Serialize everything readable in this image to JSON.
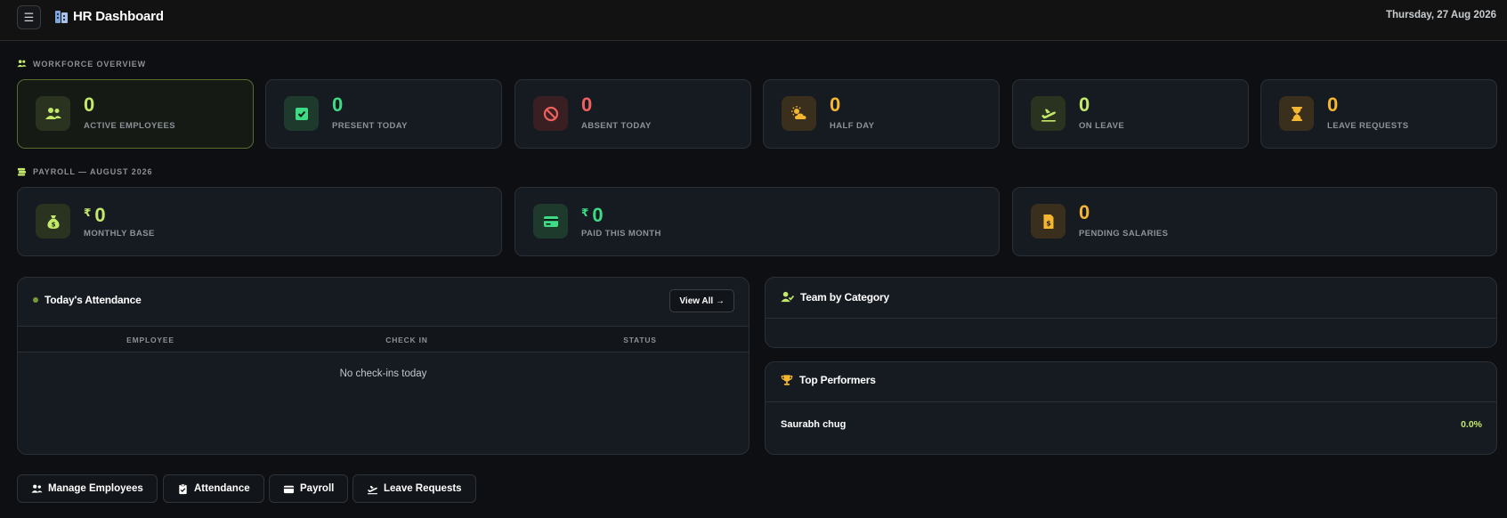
{
  "header": {
    "title": "HR Dashboard",
    "date": "Thursday, 27 Aug 2026",
    "menu_icon": "hamburger-menu-icon",
    "brand_icon": "building-icon"
  },
  "workforce": {
    "label": "WORKFORCE OVERVIEW",
    "cards": [
      {
        "value": "0",
        "label": "ACTIVE EMPLOYEES",
        "icon": "users-icon",
        "color": "#c4e86a"
      },
      {
        "value": "0",
        "label": "PRESENT TODAY",
        "icon": "check-square-icon",
        "color": "#3ddc84"
      },
      {
        "value": "0",
        "label": "ABSENT TODAY",
        "icon": "ban-icon",
        "color": "#f0605e"
      },
      {
        "value": "0",
        "label": "HALF DAY",
        "icon": "cloud-sun-icon",
        "color": "#f5b731"
      },
      {
        "value": "0",
        "label": "ON LEAVE",
        "icon": "plane-departure-icon",
        "color": "#c4e86a"
      },
      {
        "value": "0",
        "label": "LEAVE REQUESTS",
        "icon": "hourglass-icon",
        "color": "#f5b731"
      }
    ]
  },
  "payroll": {
    "label": "PAYROLL — AUGUST 2026",
    "cards": [
      {
        "currency": "₹",
        "value": "0",
        "label": "MONTHLY BASE",
        "icon": "money-bag-icon",
        "color": "#c4e86a"
      },
      {
        "currency": "₹",
        "value": "0",
        "label": "PAID THIS MONTH",
        "icon": "credit-card-icon",
        "color": "#3ddc84"
      },
      {
        "value": "0",
        "label": "PENDING SALARIES",
        "icon": "invoice-dollar-icon",
        "color": "#f5b731"
      }
    ]
  },
  "attendance": {
    "title": "Today's Attendance",
    "view_all": "View All →",
    "columns": [
      "EMPLOYEE",
      "CHECK IN",
      "STATUS"
    ],
    "empty_text": "No check-ins today"
  },
  "team": {
    "title": "Team by Category",
    "icon": "user-group-icon"
  },
  "performers": {
    "title": "Top Performers",
    "icon": "trophy-icon",
    "items": [
      {
        "name": "Saurabh chug",
        "value": "0.0%"
      }
    ]
  },
  "quick_actions": [
    {
      "label": "Manage Employees",
      "icon": "users-icon"
    },
    {
      "label": "Attendance",
      "icon": "clipboard-check-icon"
    },
    {
      "label": "Payroll",
      "icon": "wallet-icon"
    },
    {
      "label": "Leave Requests",
      "icon": "plane-departure-icon"
    }
  ]
}
